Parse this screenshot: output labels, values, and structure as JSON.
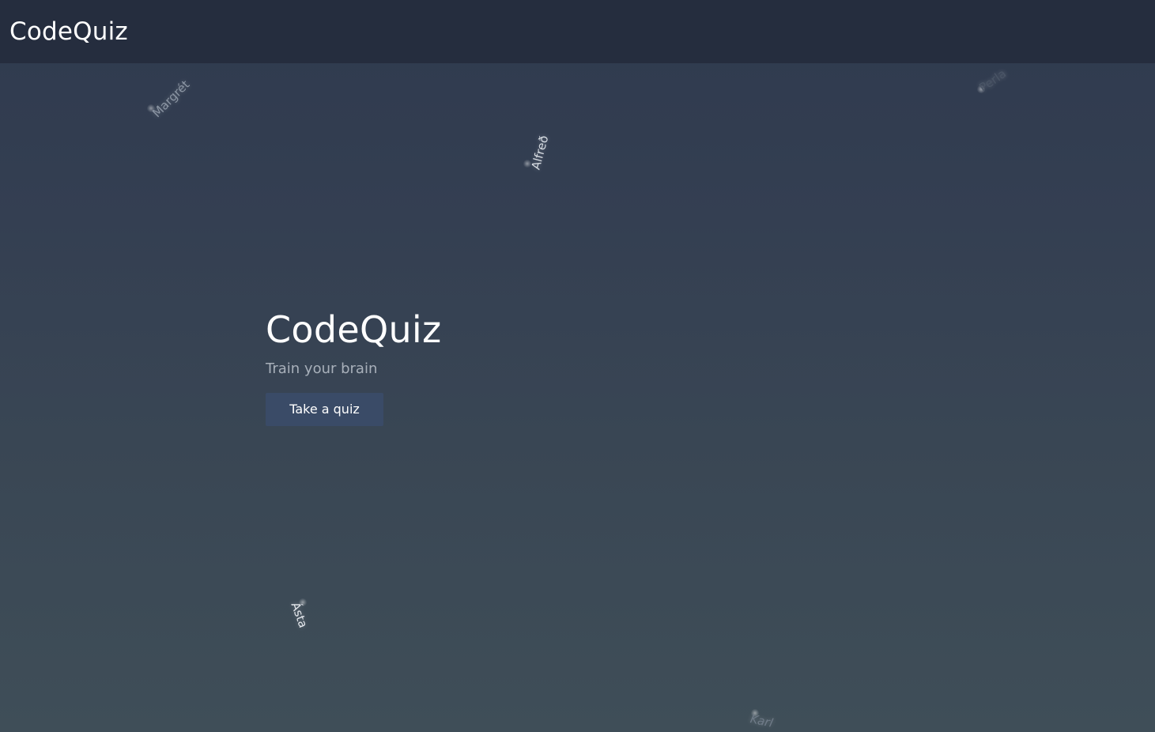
{
  "navbar": {
    "brand": "CodeQuiz"
  },
  "hero": {
    "title": "CodeQuiz",
    "subtitle": "Train your brain",
    "cta_label": "Take a quiz"
  },
  "floating_names": [
    {
      "name": "Margrét",
      "color": "#8c96a4"
    },
    {
      "name": "Alfreð",
      "color": "#d8dde3"
    },
    {
      "name": "Perla",
      "color": "#4a5566"
    },
    {
      "name": "Ásta",
      "color": "#e6e9ee"
    },
    {
      "name": "Karl",
      "color": "#6f7b88"
    }
  ],
  "colors": {
    "navbar_bg": "#252d3e",
    "button_bg": "#3a4b67",
    "subtitle": "#a8b0ba"
  }
}
